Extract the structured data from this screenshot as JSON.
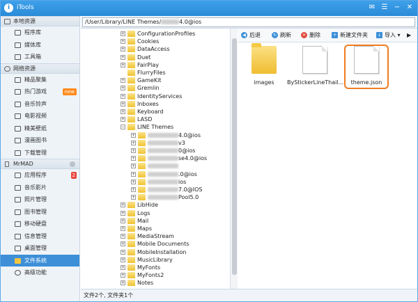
{
  "app": {
    "title": "iTools"
  },
  "sidebar": {
    "sections": [
      {
        "label": "本地资源",
        "items": [
          {
            "label": "程序库"
          },
          {
            "label": "媒体库"
          },
          {
            "label": "工具箱"
          }
        ]
      },
      {
        "label": "网络资源",
        "items": [
          {
            "label": "精品聚集"
          },
          {
            "label": "热门游戏",
            "badge": "new"
          },
          {
            "label": "音乐铃声"
          },
          {
            "label": "电影视频"
          },
          {
            "label": "精美壁纸"
          },
          {
            "label": "漫画图书"
          },
          {
            "label": "下载管理"
          }
        ]
      },
      {
        "label": "MrMAD",
        "items": [
          {
            "label": "应用程序",
            "badge": "2"
          },
          {
            "label": "音乐影片"
          },
          {
            "label": "照片管理"
          },
          {
            "label": "图书管理"
          },
          {
            "label": "移动硬盘"
          },
          {
            "label": "信息管理"
          },
          {
            "label": "桌面管理"
          },
          {
            "label": "文件系统",
            "selected": true
          },
          {
            "label": "高级功能"
          }
        ]
      }
    ]
  },
  "path": {
    "prefix": "/User/Library/LINE Themes/",
    "suffix": "4.0@ios"
  },
  "tree": {
    "items": [
      {
        "label": "ConfigurationProfiles"
      },
      {
        "label": "Cookies"
      },
      {
        "label": "DataAccess"
      },
      {
        "label": "Duet"
      },
      {
        "label": "FairPlay"
      },
      {
        "label": "FlurryFiles",
        "noexp": true
      },
      {
        "label": "GameKit"
      },
      {
        "label": "Gremlin"
      },
      {
        "label": "IdentityServices"
      },
      {
        "label": "Inboxes"
      },
      {
        "label": "Keyboard"
      },
      {
        "label": "LASD"
      },
      {
        "label": "LINE Themes",
        "expanded": true
      },
      {
        "label": "",
        "blur": "4.0@ios",
        "child": true
      },
      {
        "label": "",
        "blur": "v3",
        "child": true
      },
      {
        "label": "",
        "blur": "0@ios",
        "child": true
      },
      {
        "label": "",
        "blur": "se4.0@ios",
        "child": true
      },
      {
        "label": "",
        "blur": "",
        "child": true
      },
      {
        "label": "",
        "blur": ".0@ios",
        "child": true
      },
      {
        "label": "",
        "blur": "ios",
        "child": true
      },
      {
        "label": "",
        "blur": "7.0@IOS",
        "child": true
      },
      {
        "label": "",
        "blur": "Pool5.0",
        "child": true
      },
      {
        "label": "LibHide"
      },
      {
        "label": "Logs"
      },
      {
        "label": "Mail"
      },
      {
        "label": "Maps"
      },
      {
        "label": "MediaStream"
      },
      {
        "label": "Mobile Documents"
      },
      {
        "label": "MobileInstallation"
      },
      {
        "label": "MusicLibrary"
      },
      {
        "label": "MyFonts"
      },
      {
        "label": "MyFonts2"
      },
      {
        "label": "Notes"
      }
    ]
  },
  "toolbar": {
    "back": "后退",
    "refresh": "刷新",
    "delete": "删除",
    "newfolder": "新建文件夹",
    "import": "导入"
  },
  "files": [
    {
      "label": "images"
    },
    {
      "label": "ByStickerLineThail..."
    },
    {
      "label": "theme.json"
    }
  ],
  "status": "文件2个, 文件夹1个"
}
